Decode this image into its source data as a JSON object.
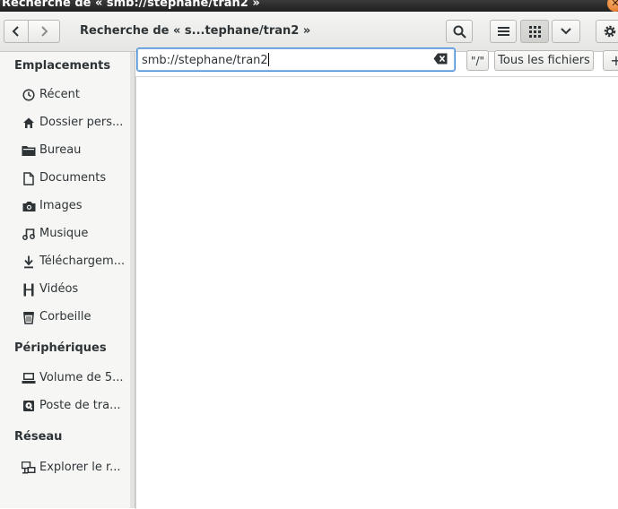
{
  "window": {
    "title": "Recherche de « smb://stephane/tran2 »",
    "close_glyph": "✕"
  },
  "header": {
    "title": "Recherche de « s...tephane/tran2 »"
  },
  "location": {
    "value": "smb://stephane/tran2"
  },
  "toolbar": {
    "root_label": "\"/\"",
    "filter_label": "Tous les fichiers",
    "add_label": "+"
  },
  "sidebar": {
    "sections": [
      {
        "title": "Emplacements"
      },
      {
        "title": "Périphériques"
      },
      {
        "title": "Réseau"
      }
    ],
    "items": [
      {
        "label": "Récent",
        "icon": "clock-icon"
      },
      {
        "label": "Dossier pers...",
        "icon": "home-icon"
      },
      {
        "label": "Bureau",
        "icon": "folder-icon"
      },
      {
        "label": "Documents",
        "icon": "document-icon"
      },
      {
        "label": "Images",
        "icon": "camera-icon"
      },
      {
        "label": "Musique",
        "icon": "music-icon"
      },
      {
        "label": "Téléchargem...",
        "icon": "download-icon"
      },
      {
        "label": "Vidéos",
        "icon": "film-icon"
      },
      {
        "label": "Corbeille",
        "icon": "trash-icon"
      },
      {
        "label": "Volume de 5...",
        "icon": "drive-icon"
      },
      {
        "label": "Poste de tra...",
        "icon": "computer-icon"
      },
      {
        "label": "Explorer le r...",
        "icon": "network-icon"
      }
    ]
  },
  "colors": {
    "accent": "#4a90d9",
    "sidebar_bg": "#f6f6f5",
    "title_bg": "#2a2a2a"
  }
}
